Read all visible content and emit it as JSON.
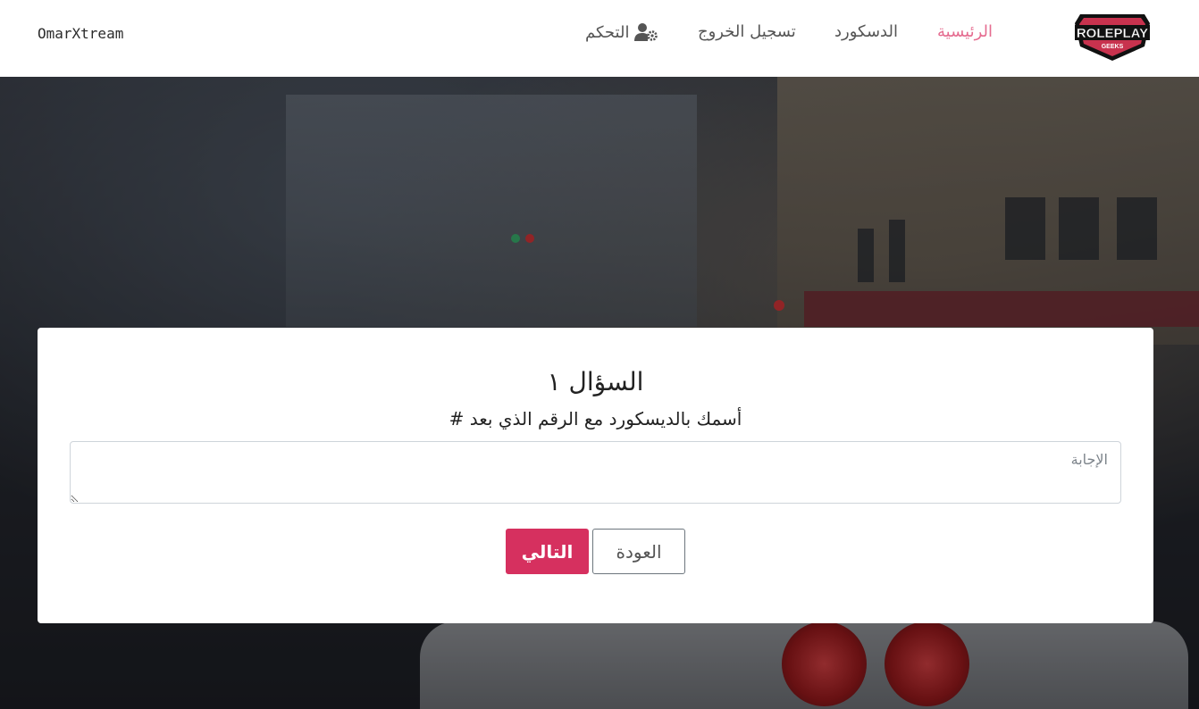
{
  "navbar": {
    "username": "OmarXtream",
    "links": {
      "home": "الرئيسية",
      "discord": "الدسكورد",
      "logout": "تسجيل الخروج",
      "panel": "التحكم"
    },
    "active": "home",
    "active_color": "#e56b8f",
    "logo": {
      "text_top": "ROLEPLAY",
      "text_bottom": "GEEKS",
      "icon": "roleplay-geeks-logo"
    },
    "panel_icon": "users-cog-icon"
  },
  "question": {
    "title": "السؤال ١",
    "text": "أسمك بالديسكورد مع الرقم الذي بعد #",
    "answer_placeholder": "الإجابة",
    "answer_value": ""
  },
  "buttons": {
    "next": "التالي",
    "back": "العودة",
    "next_color": "#d6305f"
  }
}
